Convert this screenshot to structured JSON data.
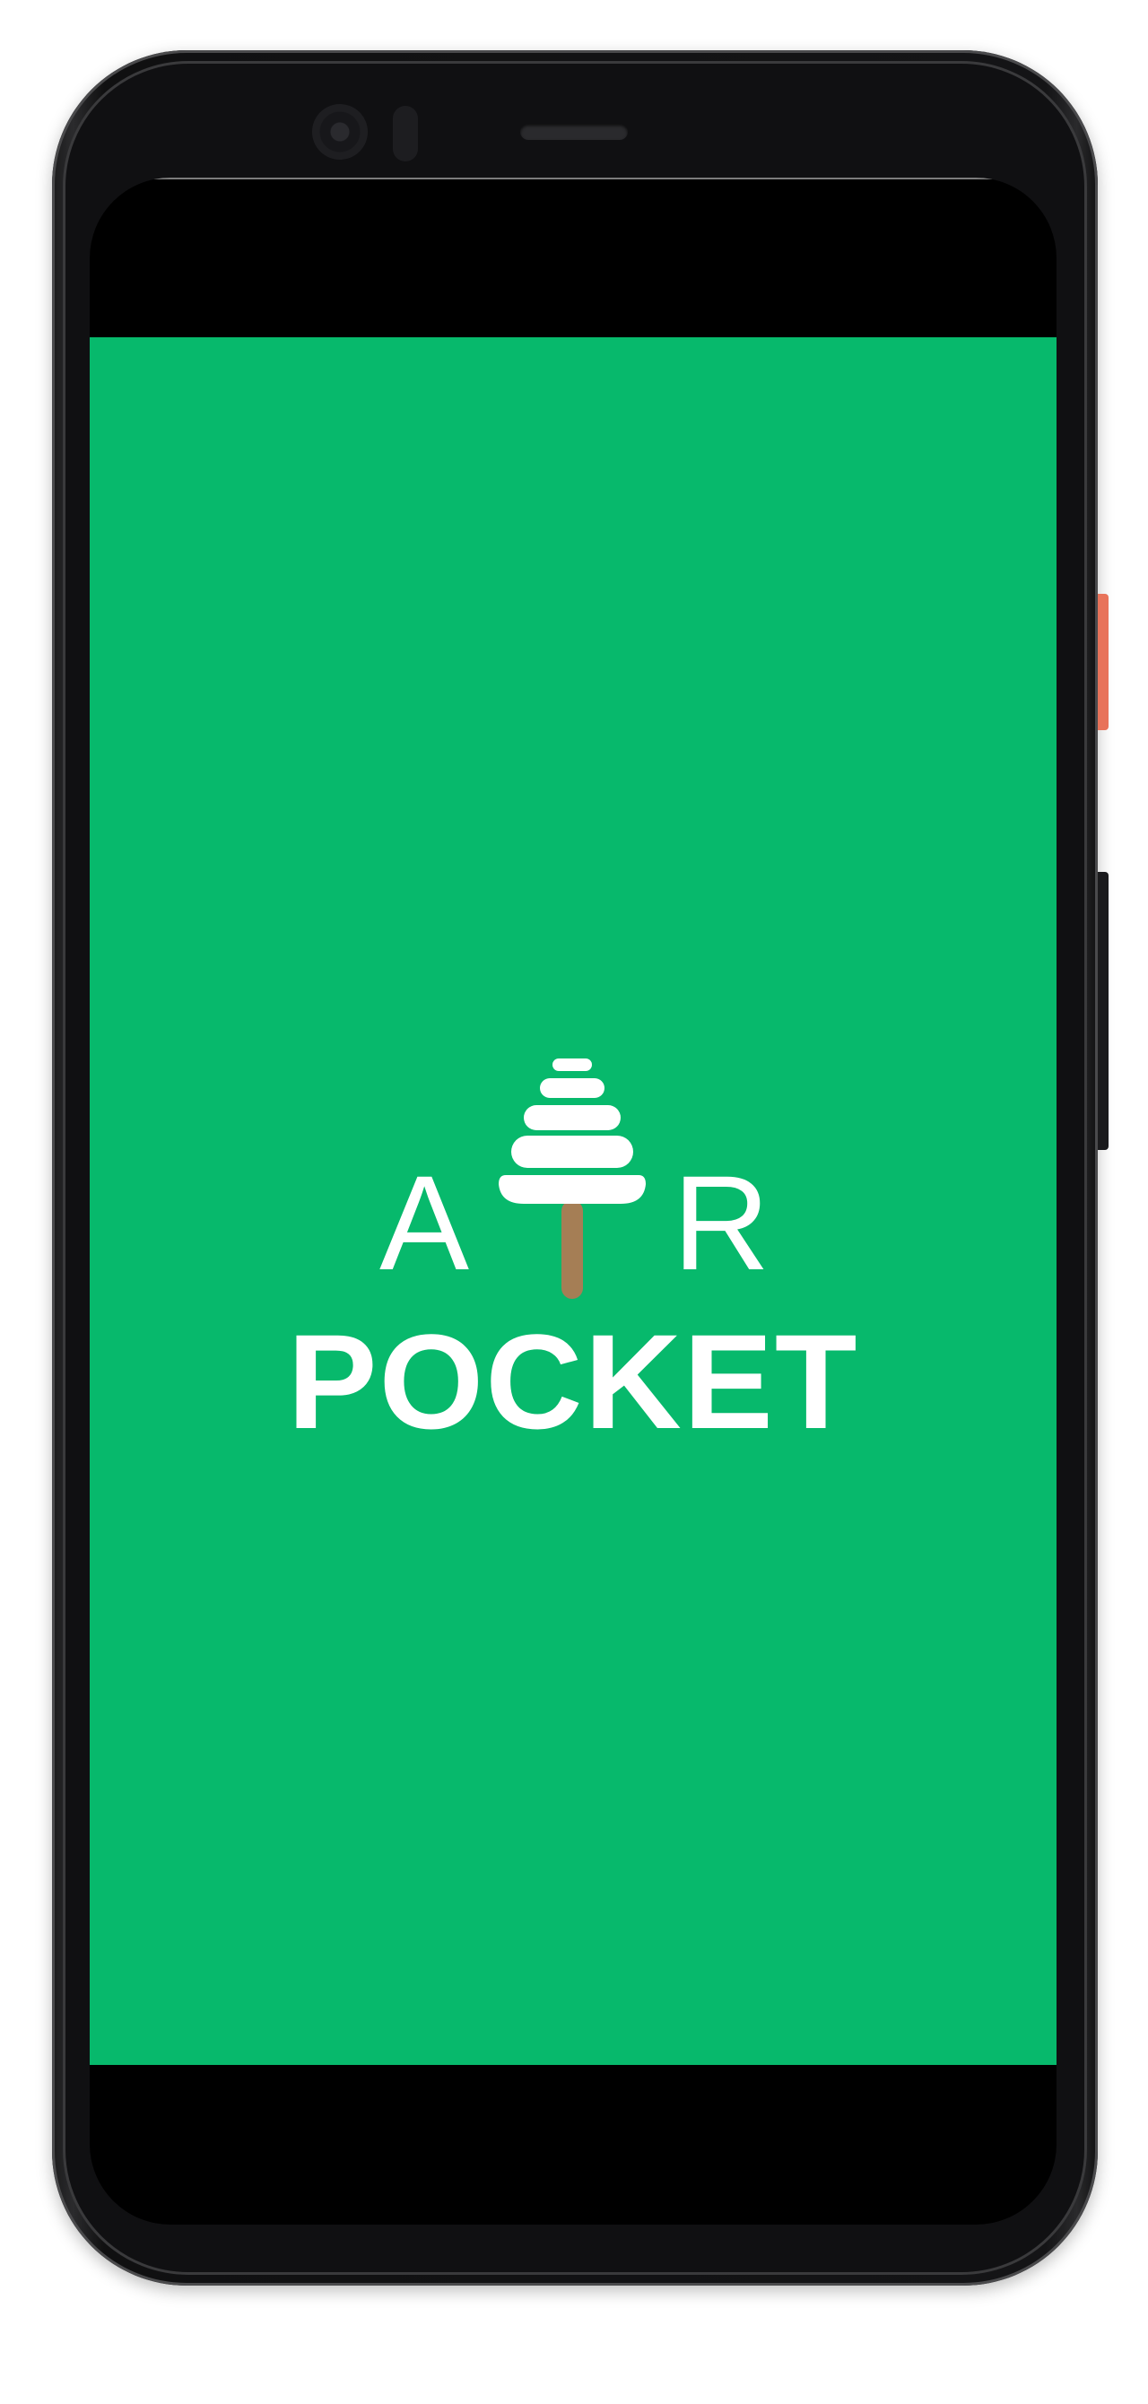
{
  "app": {
    "logo_line1_left": "A",
    "logo_line1_right": "R",
    "logo_line2": "POCKET",
    "logo_icon": "tree-icon"
  },
  "colors": {
    "splash_background": "#07b96c",
    "logo_foreground": "#ffffff",
    "tree_trunk": "#a57e55",
    "power_button": "#e8735a"
  }
}
